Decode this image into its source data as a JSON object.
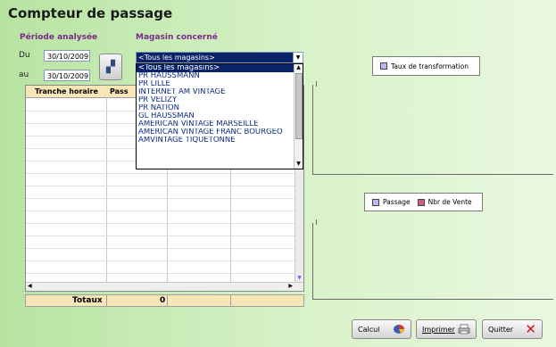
{
  "title": "Compteur de passage",
  "period": {
    "label": "Période analysée",
    "from_label": "Du",
    "from_value": "30/10/2009",
    "to_label": "au",
    "to_value": "30/10/2009"
  },
  "store": {
    "label": "Magasin concerné",
    "selected": "<Tous les magasins>",
    "options": [
      "<Tous les magasins>",
      "PR HAUSSMANN",
      "PR LILLE",
      "INTERNET AM VINTAGE",
      "PR VELIZY",
      "PR NATION",
      "GL HAUSSMAN",
      "AMERICAN VINTAGE MARSEILLE",
      "AMERICAN VINTAGE FRANC BOURGEO",
      "AMVINTAGE TIQUETONNE"
    ]
  },
  "table": {
    "columns": [
      "Tranche horaire",
      "Pass"
    ],
    "totals_label": "Totaux",
    "totals_value": "0"
  },
  "legends": {
    "chart1": [
      {
        "label": "Taux de transformation",
        "color": "#b9b6f2"
      }
    ],
    "chart2": [
      {
        "label": "Passage",
        "color": "#b9b6f2"
      },
      {
        "label": "Nbr de Vente",
        "color": "#d05a8a"
      }
    ]
  },
  "buttons": {
    "calc": "Calcul",
    "print": "Imprimer",
    "quit": "Quitter"
  }
}
